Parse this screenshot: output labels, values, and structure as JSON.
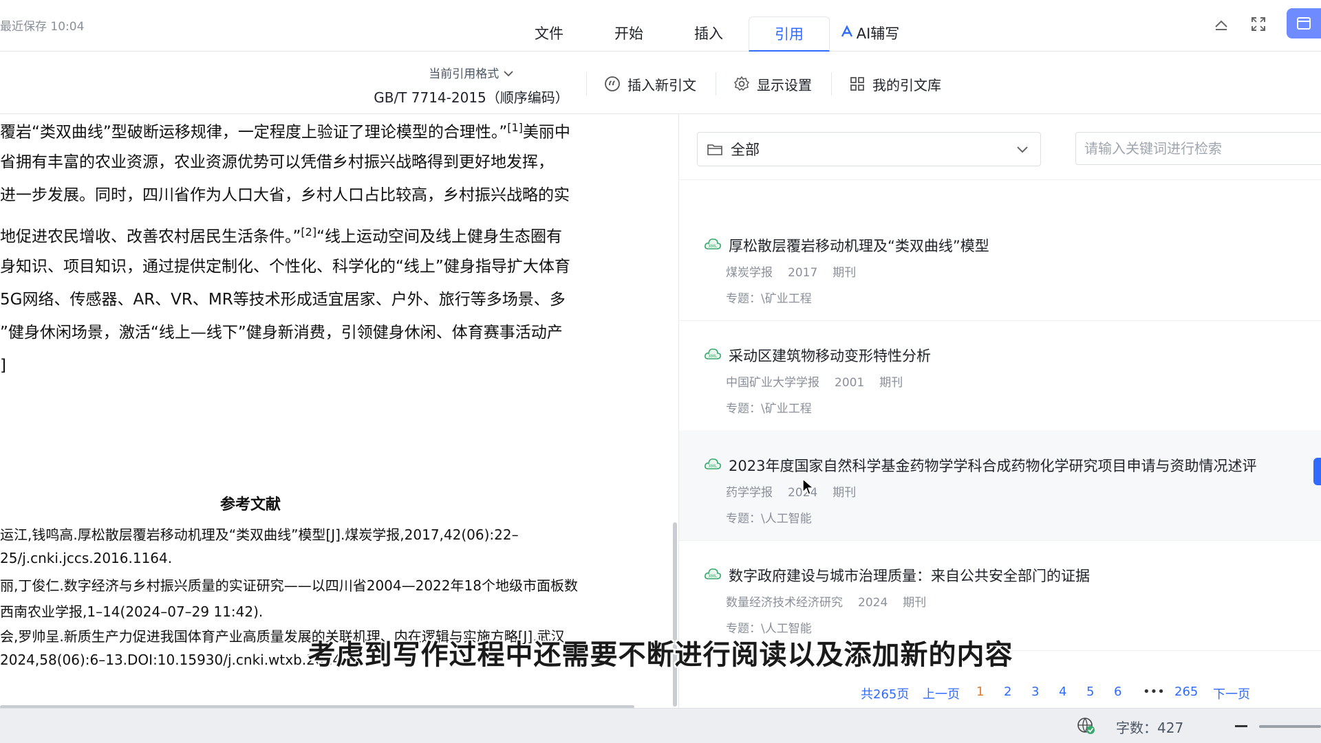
{
  "topbar": {
    "save_status": "最近保存 10:04",
    "tabs": [
      {
        "label": "文件"
      },
      {
        "label": "开始"
      },
      {
        "label": "插入"
      },
      {
        "label": "引用"
      },
      {
        "label": "AI辅写"
      }
    ],
    "active_tab": "引用"
  },
  "toolbar": {
    "format_label": "当前引用格式",
    "format_value": "GB/T 7714-2015（顺序编码）",
    "insert_citation": "插入新引文",
    "display_settings": "显示设置",
    "my_library": "我的引文库"
  },
  "document": {
    "paragraphs": [
      "覆岩“类双曲线”型破断运移规律，一定程度上验证了理论模型的合理性。”",
      "省拥有丰富的农业资源，农业资源优势可以凭借乡村振兴战略得到更好地发挥，",
      "进一步发展。同时，四川省作为人口大省，乡村人口占比较高，乡村振兴战略的实",
      "地促进农民增收、改善农村居民生活条件。”",
      "身知识、项目知识，通过提供定制化、个性化、科学化的“线上”健身指导扩大体育",
      "5G网络、传感器、AR、VR、MR等技术形成适宜居家、户外、旅行等多场景、多",
      "”健身休闲场景，激活“线上—线下”健身新消费，引领健身休闲、体育赛事活动产",
      "]"
    ],
    "para1_sup": "[1]",
    "para1_tail": "美丽中",
    "para4_sup": "[2]",
    "para4_tail": "“线上运动空间及线上健身生态圈有",
    "refs_title": "参考文献",
    "refs": [
      "运江,钱鸣高.厚松散层覆岩移动机理及“类双曲线”模型[J].煤炭学报,2017,42(06):22–",
      "25/j.cnki.jccs.2016.1164.",
      "丽,丁俊仁.数字经济与乡村振兴质量的实证研究——以四川省2004—2022年18个地级市面板数",
      "西南农业学报,1–14(2024–07–29 11:42).",
      "会,罗帅呈.新质生产力促进我国体育产业高质量发展的关联机理、内在逻辑与实施方略[J].武汉",
      "2024,58(06):6–13.DOI:10.15930/j.cnki.wtxb.2024"
    ]
  },
  "panel": {
    "filter_value": "全部",
    "search_placeholder": "请输入关键词进行检索",
    "results": [
      {
        "title": "厚松散层覆岩移动机理及“类双曲线”模型",
        "journal": "煤炭学报",
        "year": "2017",
        "type": "期刊",
        "topic": "专题：\\矿业工程"
      },
      {
        "title": "采动区建筑物移动变形特性分析",
        "journal": "中国矿业大学学报",
        "year": "2001",
        "type": "期刊",
        "topic": "专题：\\矿业工程"
      },
      {
        "title": "2023年度国家自然科学基金药物学学科合成药物化学研究项目申请与资助情况述评",
        "journal": "药学学报",
        "year": "2024",
        "type": "期刊",
        "topic": "专题：\\人工智能"
      },
      {
        "title": "数字政府建设与城市治理质量：来自公共安全部门的证据",
        "journal": "数量经济技术经济研究",
        "year": "2024",
        "type": "期刊",
        "topic": "专题：\\人工智能"
      }
    ],
    "pagination": {
      "total": "共265页",
      "prev": "上一页",
      "pages": [
        "1",
        "2",
        "3",
        "4",
        "5",
        "6"
      ],
      "ellipsis": "•••",
      "last": "265",
      "next": "下一页",
      "current": "1"
    }
  },
  "subtitle": "考虑到写作过程中还需要不断进行阅读以及添加新的内容",
  "statusbar": {
    "word_count": "字数：427"
  },
  "colors": {
    "accent": "#2f6bff",
    "current_page": "#e8792a",
    "xml_icon": "#3aa76d"
  }
}
